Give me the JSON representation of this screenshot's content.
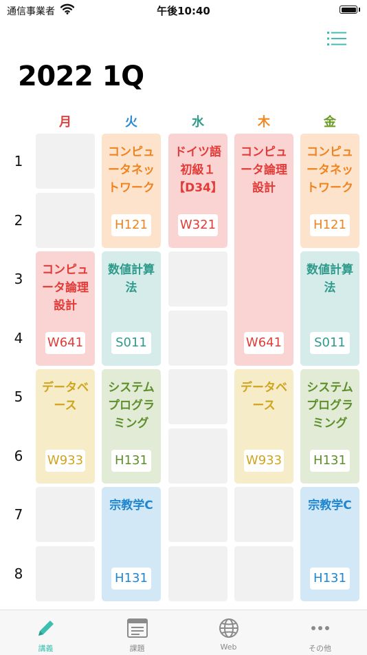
{
  "status_bar": {
    "carrier": "通信事業者",
    "time": "午後10:40"
  },
  "header": {
    "title": "2022 1Q"
  },
  "days": [
    {
      "label": "月",
      "color": "#e0413f"
    },
    {
      "label": "火",
      "color": "#2a8ad2"
    },
    {
      "label": "水",
      "color": "#2f9c8e"
    },
    {
      "label": "木",
      "color": "#ee8a20"
    },
    {
      "label": "金",
      "color": "#6a9b27"
    }
  ],
  "periods": [
    "1",
    "2",
    "3",
    "4",
    "5",
    "6",
    "7",
    "8"
  ],
  "themes": {
    "orange": {
      "bg": "#fde3cb",
      "fg": "#ee8421"
    },
    "red": {
      "bg": "#f9d4d3",
      "fg": "#e33b37"
    },
    "teal": {
      "bg": "#d5ecea",
      "fg": "#2f9a8c"
    },
    "yellow": {
      "bg": "#f6ecc8",
      "fg": "#cfa41f"
    },
    "green": {
      "bg": "#e1ebd6",
      "fg": "#5e8e2b"
    },
    "blue": {
      "bg": "#d2e8f6",
      "fg": "#1f86cf"
    }
  },
  "classes": [
    {
      "day": 1,
      "start": 1,
      "span": 2,
      "name": "コンピュータネットワーク",
      "room": "H121",
      "theme": "orange"
    },
    {
      "day": 2,
      "start": 1,
      "span": 2,
      "name": "ドイツ語初級１【D34】",
      "room": "W321",
      "theme": "red"
    },
    {
      "day": 3,
      "start": 1,
      "span": 4,
      "name": "コンピュータ論理設計",
      "room": "W641",
      "theme": "red"
    },
    {
      "day": 4,
      "start": 1,
      "span": 2,
      "name": "コンピュータネットワーク",
      "room": "H121",
      "theme": "orange"
    },
    {
      "day": 0,
      "start": 3,
      "span": 2,
      "name": "コンピュータ論理設計",
      "room": "W641",
      "theme": "red"
    },
    {
      "day": 1,
      "start": 3,
      "span": 2,
      "name": "数値計算法",
      "room": "S011",
      "theme": "teal"
    },
    {
      "day": 4,
      "start": 3,
      "span": 2,
      "name": "数値計算法",
      "room": "S011",
      "theme": "teal"
    },
    {
      "day": 0,
      "start": 5,
      "span": 2,
      "name": "データベース",
      "room": "W933",
      "theme": "yellow"
    },
    {
      "day": 1,
      "start": 5,
      "span": 2,
      "name": "システムプログラミング",
      "room": "H131",
      "theme": "green"
    },
    {
      "day": 3,
      "start": 5,
      "span": 2,
      "name": "データベース",
      "room": "W933",
      "theme": "yellow"
    },
    {
      "day": 4,
      "start": 5,
      "span": 2,
      "name": "システムプログラミング",
      "room": "H131",
      "theme": "green"
    },
    {
      "day": 1,
      "start": 7,
      "span": 2,
      "name": "宗教学C",
      "room": "H131",
      "theme": "blue"
    },
    {
      "day": 4,
      "start": 7,
      "span": 2,
      "name": "宗教学C",
      "room": "H131",
      "theme": "blue"
    }
  ],
  "empty_cells": [
    {
      "day": 0,
      "period": 1
    },
    {
      "day": 0,
      "period": 2
    },
    {
      "day": 2,
      "period": 3
    },
    {
      "day": 2,
      "period": 4
    },
    {
      "day": 2,
      "period": 5
    },
    {
      "day": 2,
      "period": 6
    },
    {
      "day": 0,
      "period": 7
    },
    {
      "day": 0,
      "period": 8
    },
    {
      "day": 2,
      "period": 7
    },
    {
      "day": 2,
      "period": 8
    },
    {
      "day": 3,
      "period": 7
    },
    {
      "day": 3,
      "period": 8
    }
  ],
  "tabs": [
    {
      "label": "講義",
      "icon": "pencil-icon",
      "active": true
    },
    {
      "label": "課題",
      "icon": "document-icon",
      "active": false
    },
    {
      "label": "Web",
      "icon": "globe-icon",
      "active": false
    },
    {
      "label": "その他",
      "icon": "more-icon",
      "active": false
    }
  ],
  "accent_color": "#3cbfb1"
}
